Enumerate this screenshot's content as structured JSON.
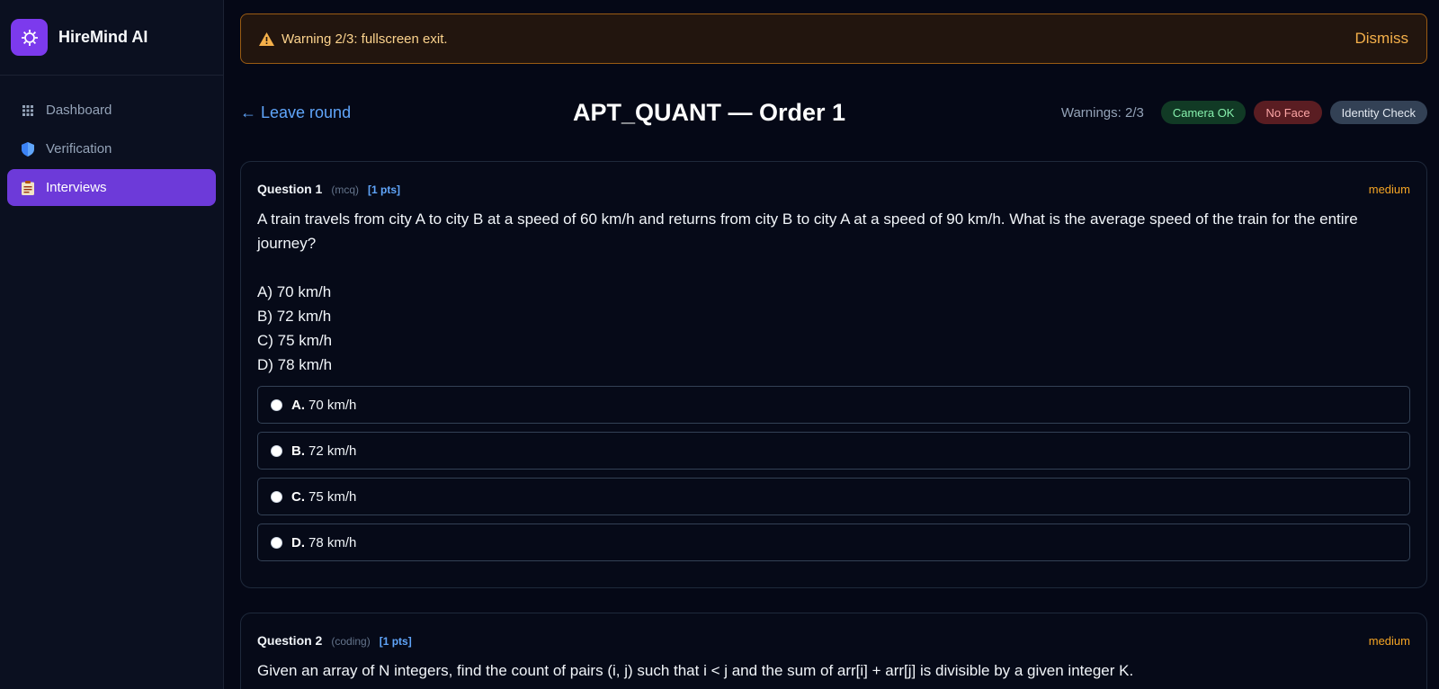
{
  "brand": {
    "name": "HireMind AI"
  },
  "sidebar": {
    "items": [
      {
        "label": "Dashboard",
        "icon": "grid-icon",
        "active": false
      },
      {
        "label": "Verification",
        "icon": "shield-icon",
        "active": false
      },
      {
        "label": "Interviews",
        "icon": "clipboard-icon",
        "active": true
      }
    ]
  },
  "banner": {
    "message": "Warning 2/3: fullscreen exit.",
    "dismiss_label": "Dismiss"
  },
  "header": {
    "leave_label": "← Leave round",
    "title": "APT_QUANT — Order 1",
    "warnings": "Warnings: 2/3",
    "status_pills": [
      "Camera OK",
      "No Face",
      "Identity Check"
    ]
  },
  "questions": [
    {
      "label": "Question 1",
      "type": "(mcq)",
      "points": "[1 pts]",
      "difficulty": "medium",
      "text": "A train travels from city A to city B at a speed of 60 km/h and returns from city B to city A at a speed of 90 km/h. What is the average speed of the train for the entire journey?\n\nA) 70 km/h\nB) 72 km/h\nC) 75 km/h\nD) 78 km/h",
      "options": [
        {
          "letter": "A.",
          "text": "70 km/h"
        },
        {
          "letter": "B.",
          "text": "72 km/h"
        },
        {
          "letter": "C.",
          "text": "75 km/h"
        },
        {
          "letter": "D.",
          "text": "78 km/h"
        }
      ]
    },
    {
      "label": "Question 2",
      "type": "(coding)",
      "points": "[1 pts]",
      "difficulty": "medium",
      "text": "Given an array of N integers, find the count of pairs (i, j) such that i < j and the sum of arr[i] + arr[j] is divisible by a given integer K."
    }
  ],
  "colors": {
    "accent": "#7c3aed",
    "warning": "#f5b04a",
    "link": "#60a5fa",
    "background": "#050816"
  }
}
